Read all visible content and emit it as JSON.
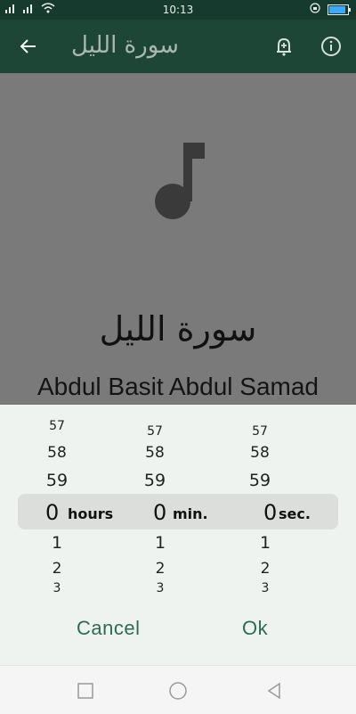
{
  "status_bar": {
    "time": "10:13",
    "left_icons": [
      "signal-icon",
      "signal-icon",
      "wifi-icon"
    ],
    "right_icons": [
      "rotation-lock-icon",
      "battery-icon"
    ]
  },
  "app_bar": {
    "title": "سورة الليل",
    "icons": [
      "back-arrow-icon",
      "alarm-add-icon",
      "info-icon"
    ]
  },
  "player": {
    "icon": "music-note-icon",
    "surah_title": "سورة الليل",
    "reciter": "Abdul Basit Abdul Samad"
  },
  "timer_picker": {
    "hours": {
      "above": [
        "57",
        "58",
        "59"
      ],
      "selected": "0",
      "unit": "hours",
      "below": [
        "1",
        "2",
        "3"
      ]
    },
    "minutes": {
      "above": [
        "57",
        "58",
        "59"
      ],
      "selected": "0",
      "unit": "min.",
      "below": [
        "1",
        "2",
        "3"
      ]
    },
    "seconds": {
      "above": [
        "57",
        "58",
        "59"
      ],
      "selected": "0",
      "unit": "sec.",
      "below": [
        "1",
        "2",
        "3"
      ]
    }
  },
  "dialog": {
    "cancel_label": "Cancel",
    "ok_label": "Ok"
  },
  "nav_bar": {
    "icons": [
      "recents-icon",
      "home-icon",
      "back-icon"
    ]
  },
  "colors": {
    "app_bar": "#1e4637",
    "status_bar": "#163a2d",
    "accent": "#2e6b53",
    "scrim": "#7a7a7a"
  }
}
